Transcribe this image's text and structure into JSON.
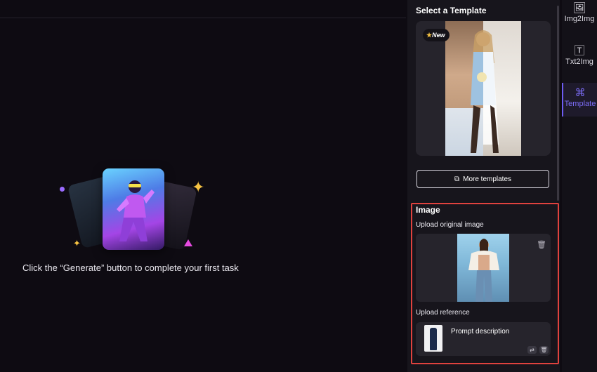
{
  "main": {
    "empty_text": "Click the “Generate” button to complete your first task"
  },
  "panel": {
    "title": "Select a Template",
    "badge_new": "New",
    "more_templates_label": "More templates",
    "image_section": {
      "title": "Image",
      "upload_original_label": "Upload original image",
      "upload_reference_label": "Upload reference",
      "prompt_description": "Prompt description"
    }
  },
  "nav": {
    "items": [
      {
        "label": "Img2Img",
        "icon": "image-plus-icon"
      },
      {
        "label": "Txt2Img",
        "icon": "text-plus-icon"
      },
      {
        "label": "Template",
        "icon": "template-icon"
      }
    ],
    "active": "Template"
  },
  "colors": {
    "accent": "#7c6cf6",
    "highlight_border": "#e0423e",
    "background": "#0e0b12",
    "panel": "#17151c"
  }
}
